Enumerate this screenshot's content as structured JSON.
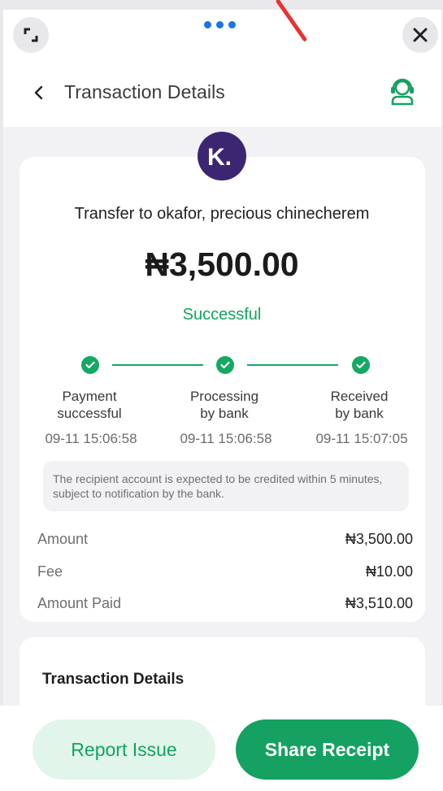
{
  "window": {
    "menu_dots": "more-dots"
  },
  "header": {
    "title": "Transaction Details"
  },
  "recipient": {
    "logo_letter": "K.",
    "transfer_text": "Transfer to okafor, precious chinecherem",
    "amount": "₦3,500.00",
    "status": "Successful"
  },
  "steps": [
    {
      "label_line1": "Payment",
      "label_line2": "successful",
      "time": "09-11 15:06:58"
    },
    {
      "label_line1": "Processing",
      "label_line2": "by bank",
      "time": "09-11 15:06:58"
    },
    {
      "label_line1": "Received",
      "label_line2": "by bank",
      "time": "09-11 15:07:05"
    }
  ],
  "notice": "The recipient account is expected to be credited within 5 minutes, subject to notification by the bank.",
  "summary": [
    {
      "label": "Amount",
      "value": "₦3,500.00"
    },
    {
      "label": "Fee",
      "value": "₦10.00"
    },
    {
      "label": "Amount Paid",
      "value": "₦3,510.00"
    }
  ],
  "details_section": {
    "title": "Transaction Details"
  },
  "actions": {
    "report": "Report Issue",
    "share": "Share Receipt"
  },
  "colors": {
    "accent": "#14a161",
    "logo_bg": "#3c2672",
    "dots": "#1a73e8"
  }
}
